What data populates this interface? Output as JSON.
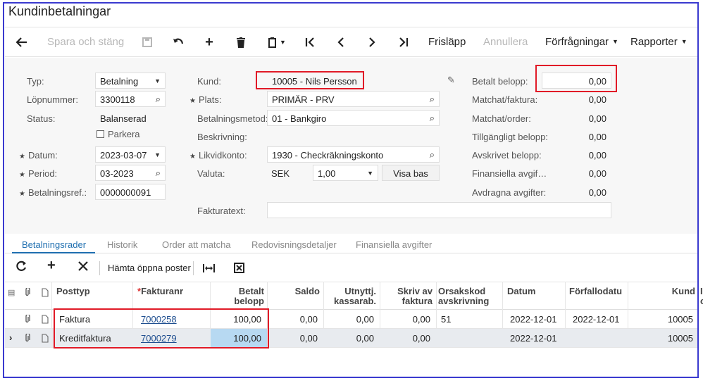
{
  "window": {
    "title": "Kundinbetalningar"
  },
  "toolbar": {
    "back_icon": "arrow-left",
    "save_close": "Spara och stäng",
    "save_icon": "floppy",
    "undo_icon": "undo",
    "add_icon": "plus",
    "delete_icon": "trash",
    "copy_paste_icon": "clipboard",
    "first_icon": "first",
    "prev_icon": "prev",
    "next_icon": "next",
    "last_icon": "last",
    "release": "Frisläpp",
    "cancel": "Annullera",
    "inquiries": "Förfrågningar",
    "reports": "Rapporter"
  },
  "form": {
    "typ_label": "Typ:",
    "typ_value": "Betalning",
    "lopnummer_label": "Löpnummer:",
    "lopnummer_value": "3300118",
    "status_label": "Status:",
    "status_value": "Balanserad",
    "parkera_label": "Parkera",
    "datum_label": "Datum:",
    "datum_value": "2023-03-07",
    "period_label": "Period:",
    "period_value": "03-2023",
    "betalningsref_label": "Betalningsref.:",
    "betalningsref_value": "0000000091",
    "kund_label": "Kund:",
    "kund_value": "10005 - Nils Persson",
    "plats_label": "Plats:",
    "plats_value": "PRIMÄR - PRV",
    "betalningsmetod_label": "Betalningsmetod:",
    "betalningsmetod_value": "01 - Bankgiro",
    "beskrivning_label": "Beskrivning:",
    "likvidkonto_label": "Likvidkonto:",
    "likvidkonto_value": "1930 - Checkräkningskonto",
    "valuta_label": "Valuta:",
    "valuta_code": "SEK",
    "valuta_rate": "1,00",
    "visa_bas": "Visa bas",
    "fakturatext_label": "Fakturatext:",
    "betalt_belopp_label": "Betalt belopp:",
    "betalt_belopp_value": "0,00",
    "matchat_faktura_label": "Matchat/faktura:",
    "matchat_faktura_value": "0,00",
    "matchat_order_label": "Matchat/order:",
    "matchat_order_value": "0,00",
    "tillgangligt_label": "Tillgängligt belopp:",
    "tillgangligt_value": "0,00",
    "avskrivet_label": "Avskrivet belopp:",
    "avskrivet_value": "0,00",
    "finansiella_label": "Finansiella avgif…",
    "finansiella_value": "0,00",
    "avdragna_label": "Avdragna avgifter:",
    "avdragna_value": "0,00"
  },
  "tabs": [
    "Betalningsrader",
    "Historik",
    "Order att matcha",
    "Redovisningsdetaljer",
    "Finansiella avgifter"
  ],
  "grid_toolbar": {
    "fetch_open": "Hämta öppna poster"
  },
  "grid": {
    "headers": {
      "posttyp": "Posttyp",
      "fakturanr": "Fakturanr",
      "betalt_1": "Betalt",
      "betalt_2": "belopp",
      "saldo": "Saldo",
      "utnyttj_1": "Utnyttj.",
      "utnyttj_2": "kassarab.",
      "skriv_1": "Skriv av",
      "skriv_2": "faktura",
      "orsak_1": "Orsakskod",
      "orsak_2": "avskrivning",
      "datum": "Datum",
      "forfallo": "Förfallodatu",
      "kund": "Kund",
      "extra_1": "I",
      "extra_2": "c"
    },
    "rows": [
      {
        "posttyp": "Faktura",
        "fakturanr": "7000258",
        "betalt": "100,00",
        "saldo": "0,00",
        "utnyttj": "0,00",
        "skriv": "0,00",
        "orsak": "51",
        "datum": "2022-12-01",
        "forfallo": "2022-12-01",
        "kund": "10005"
      },
      {
        "posttyp": "Kreditfaktura",
        "fakturanr": "7000279",
        "betalt": "100,00",
        "saldo": "0,00",
        "utnyttj": "0,00",
        "skriv": "0,00",
        "orsak": "",
        "datum": "2022-12-01",
        "forfallo": "",
        "kund": "10005"
      }
    ]
  }
}
